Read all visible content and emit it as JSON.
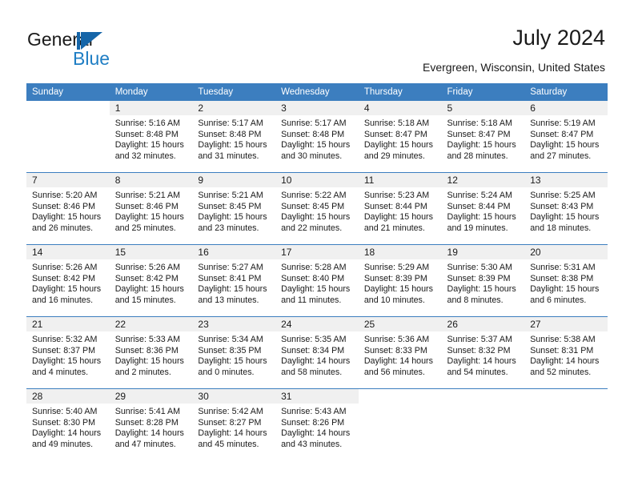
{
  "brand": {
    "name_part1": "General",
    "name_part2": "Blue",
    "mark_icon": "triangle-flag-icon",
    "accent_color": "#1f7ec4",
    "mark_color": "#1565a8"
  },
  "header": {
    "title": "July 2024",
    "location": "Evergreen, Wisconsin, United States",
    "header_bg_color": "#3c7ebf",
    "daynum_bg_color": "#f0f0f0"
  },
  "calendar": {
    "weekday_headers": [
      "Sunday",
      "Monday",
      "Tuesday",
      "Wednesday",
      "Thursday",
      "Friday",
      "Saturday"
    ],
    "labels": {
      "sunrise_prefix": "Sunrise:",
      "sunset_prefix": "Sunset:",
      "daylight_prefix": "Daylight:"
    },
    "weeks": [
      [
        {
          "day": "",
          "sunrise": "",
          "sunset": "",
          "daylight": "",
          "empty": true
        },
        {
          "day": "1",
          "sunrise": "Sunrise: 5:16 AM",
          "sunset": "Sunset: 8:48 PM",
          "daylight": "Daylight: 15 hours and 32 minutes."
        },
        {
          "day": "2",
          "sunrise": "Sunrise: 5:17 AM",
          "sunset": "Sunset: 8:48 PM",
          "daylight": "Daylight: 15 hours and 31 minutes."
        },
        {
          "day": "3",
          "sunrise": "Sunrise: 5:17 AM",
          "sunset": "Sunset: 8:48 PM",
          "daylight": "Daylight: 15 hours and 30 minutes."
        },
        {
          "day": "4",
          "sunrise": "Sunrise: 5:18 AM",
          "sunset": "Sunset: 8:47 PM",
          "daylight": "Daylight: 15 hours and 29 minutes."
        },
        {
          "day": "5",
          "sunrise": "Sunrise: 5:18 AM",
          "sunset": "Sunset: 8:47 PM",
          "daylight": "Daylight: 15 hours and 28 minutes."
        },
        {
          "day": "6",
          "sunrise": "Sunrise: 5:19 AM",
          "sunset": "Sunset: 8:47 PM",
          "daylight": "Daylight: 15 hours and 27 minutes."
        }
      ],
      [
        {
          "day": "7",
          "sunrise": "Sunrise: 5:20 AM",
          "sunset": "Sunset: 8:46 PM",
          "daylight": "Daylight: 15 hours and 26 minutes."
        },
        {
          "day": "8",
          "sunrise": "Sunrise: 5:21 AM",
          "sunset": "Sunset: 8:46 PM",
          "daylight": "Daylight: 15 hours and 25 minutes."
        },
        {
          "day": "9",
          "sunrise": "Sunrise: 5:21 AM",
          "sunset": "Sunset: 8:45 PM",
          "daylight": "Daylight: 15 hours and 23 minutes."
        },
        {
          "day": "10",
          "sunrise": "Sunrise: 5:22 AM",
          "sunset": "Sunset: 8:45 PM",
          "daylight": "Daylight: 15 hours and 22 minutes."
        },
        {
          "day": "11",
          "sunrise": "Sunrise: 5:23 AM",
          "sunset": "Sunset: 8:44 PM",
          "daylight": "Daylight: 15 hours and 21 minutes."
        },
        {
          "day": "12",
          "sunrise": "Sunrise: 5:24 AM",
          "sunset": "Sunset: 8:44 PM",
          "daylight": "Daylight: 15 hours and 19 minutes."
        },
        {
          "day": "13",
          "sunrise": "Sunrise: 5:25 AM",
          "sunset": "Sunset: 8:43 PM",
          "daylight": "Daylight: 15 hours and 18 minutes."
        }
      ],
      [
        {
          "day": "14",
          "sunrise": "Sunrise: 5:26 AM",
          "sunset": "Sunset: 8:42 PM",
          "daylight": "Daylight: 15 hours and 16 minutes."
        },
        {
          "day": "15",
          "sunrise": "Sunrise: 5:26 AM",
          "sunset": "Sunset: 8:42 PM",
          "daylight": "Daylight: 15 hours and 15 minutes."
        },
        {
          "day": "16",
          "sunrise": "Sunrise: 5:27 AM",
          "sunset": "Sunset: 8:41 PM",
          "daylight": "Daylight: 15 hours and 13 minutes."
        },
        {
          "day": "17",
          "sunrise": "Sunrise: 5:28 AM",
          "sunset": "Sunset: 8:40 PM",
          "daylight": "Daylight: 15 hours and 11 minutes."
        },
        {
          "day": "18",
          "sunrise": "Sunrise: 5:29 AM",
          "sunset": "Sunset: 8:39 PM",
          "daylight": "Daylight: 15 hours and 10 minutes."
        },
        {
          "day": "19",
          "sunrise": "Sunrise: 5:30 AM",
          "sunset": "Sunset: 8:39 PM",
          "daylight": "Daylight: 15 hours and 8 minutes."
        },
        {
          "day": "20",
          "sunrise": "Sunrise: 5:31 AM",
          "sunset": "Sunset: 8:38 PM",
          "daylight": "Daylight: 15 hours and 6 minutes."
        }
      ],
      [
        {
          "day": "21",
          "sunrise": "Sunrise: 5:32 AM",
          "sunset": "Sunset: 8:37 PM",
          "daylight": "Daylight: 15 hours and 4 minutes."
        },
        {
          "day": "22",
          "sunrise": "Sunrise: 5:33 AM",
          "sunset": "Sunset: 8:36 PM",
          "daylight": "Daylight: 15 hours and 2 minutes."
        },
        {
          "day": "23",
          "sunrise": "Sunrise: 5:34 AM",
          "sunset": "Sunset: 8:35 PM",
          "daylight": "Daylight: 15 hours and 0 minutes."
        },
        {
          "day": "24",
          "sunrise": "Sunrise: 5:35 AM",
          "sunset": "Sunset: 8:34 PM",
          "daylight": "Daylight: 14 hours and 58 minutes."
        },
        {
          "day": "25",
          "sunrise": "Sunrise: 5:36 AM",
          "sunset": "Sunset: 8:33 PM",
          "daylight": "Daylight: 14 hours and 56 minutes."
        },
        {
          "day": "26",
          "sunrise": "Sunrise: 5:37 AM",
          "sunset": "Sunset: 8:32 PM",
          "daylight": "Daylight: 14 hours and 54 minutes."
        },
        {
          "day": "27",
          "sunrise": "Sunrise: 5:38 AM",
          "sunset": "Sunset: 8:31 PM",
          "daylight": "Daylight: 14 hours and 52 minutes."
        }
      ],
      [
        {
          "day": "28",
          "sunrise": "Sunrise: 5:40 AM",
          "sunset": "Sunset: 8:30 PM",
          "daylight": "Daylight: 14 hours and 49 minutes."
        },
        {
          "day": "29",
          "sunrise": "Sunrise: 5:41 AM",
          "sunset": "Sunset: 8:28 PM",
          "daylight": "Daylight: 14 hours and 47 minutes."
        },
        {
          "day": "30",
          "sunrise": "Sunrise: 5:42 AM",
          "sunset": "Sunset: 8:27 PM",
          "daylight": "Daylight: 14 hours and 45 minutes."
        },
        {
          "day": "31",
          "sunrise": "Sunrise: 5:43 AM",
          "sunset": "Sunset: 8:26 PM",
          "daylight": "Daylight: 14 hours and 43 minutes."
        },
        {
          "day": "",
          "sunrise": "",
          "sunset": "",
          "daylight": "",
          "empty": true
        },
        {
          "day": "",
          "sunrise": "",
          "sunset": "",
          "daylight": "",
          "empty": true
        },
        {
          "day": "",
          "sunrise": "",
          "sunset": "",
          "daylight": "",
          "empty": true
        }
      ]
    ]
  }
}
